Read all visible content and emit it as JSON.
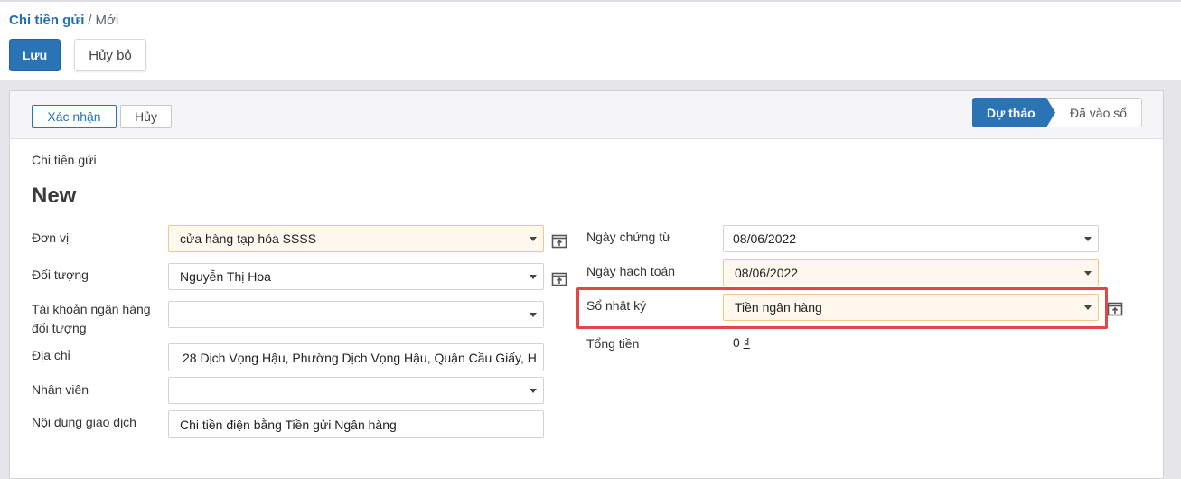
{
  "breadcrumb": {
    "parent": "Chi tiền gửi",
    "separator": "/",
    "current": "Mới"
  },
  "toolbar": {
    "save_label": "Lưu",
    "discard_label": "Hủy bỏ"
  },
  "statusbar": {
    "confirm_label": "Xác nhận",
    "cancel_label": "Hủy",
    "stages": [
      {
        "label": "Dự thảo",
        "active": true
      },
      {
        "label": "Đã vào sổ",
        "active": false
      }
    ]
  },
  "form": {
    "doc_type": "Chi tiền gửi",
    "name": "New",
    "left": {
      "don_vi": {
        "label": "Đơn vị",
        "value": "cửa hàng tạp hóa SSSS"
      },
      "doi_tuong": {
        "label": "Đối tượng",
        "value": "Nguyễn Thị Hoa"
      },
      "tk_ngan_hang": {
        "label_line1": "Tài khoản ngân hàng",
        "label_line2": "đối tượng",
        "value": ""
      },
      "dia_chi": {
        "label": "Địa chỉ",
        "value": "28 Dịch Vọng Hậu, Phường Dịch Vọng Hậu, Quận Cầu Giấy, H"
      },
      "nhan_vien": {
        "label": "Nhân viên",
        "value": ""
      },
      "noi_dung": {
        "label": "Nội dung giao dịch",
        "value": "Chi tiền điện bằng Tiền gửi Ngân hàng"
      }
    },
    "right": {
      "ngay_chung_tu": {
        "label": "Ngày chứng từ",
        "value": "08/06/2022"
      },
      "ngay_hach_toan": {
        "label": "Ngày hạch toán",
        "value": "08/06/2022"
      },
      "so_nhat_ky": {
        "label": "Sổ nhật ký",
        "value": "Tiền ngân hàng"
      },
      "tong_tien": {
        "label": "Tổng tiền",
        "amount": "0",
        "currency": "₫"
      }
    }
  },
  "colors": {
    "accent": "#2a73b5",
    "required_bg": "#fff8ee",
    "highlight": "#e04848"
  },
  "icons": {
    "external_link": "external-link-icon",
    "dropdown": "chevron-down-icon"
  }
}
